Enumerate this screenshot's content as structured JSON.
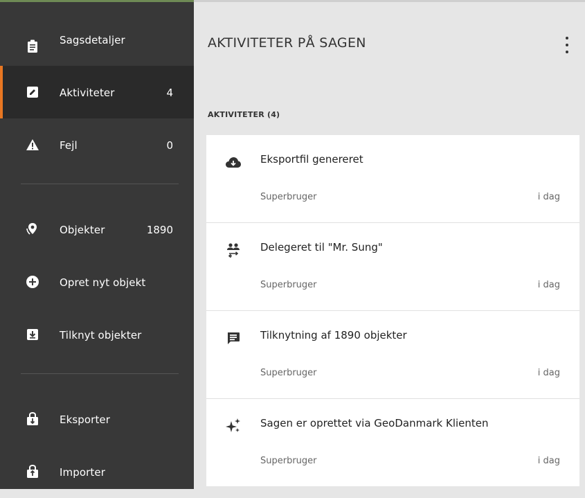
{
  "sidebar": {
    "items": [
      {
        "label": "Sagsdetaljer",
        "icon": "clipboard-icon",
        "count": ""
      },
      {
        "label": "Aktiviteter",
        "icon": "edit-note-icon",
        "count": "4"
      },
      {
        "label": "Fejl",
        "icon": "warning-icon",
        "count": "0"
      },
      {
        "label": "Objekter",
        "icon": "location-pin-icon",
        "count": "1890"
      },
      {
        "label": "Opret nyt objekt",
        "icon": "add-circle-icon",
        "count": ""
      },
      {
        "label": "Tilknyt objekter",
        "icon": "download-box-icon",
        "count": ""
      },
      {
        "label": "Eksporter",
        "icon": "lock-export-icon",
        "count": ""
      },
      {
        "label": "Importer",
        "icon": "lock-import-icon",
        "count": ""
      }
    ],
    "active_index": 1,
    "accent_color": "#e87722"
  },
  "main": {
    "title": "AKTIVITETER PÅ SAGEN",
    "section_title": "AKTIVITETER (4)",
    "activities": [
      {
        "icon": "cloud-download-icon",
        "title": "Eksportfil genereret",
        "user": "Superbruger",
        "time": "i dag"
      },
      {
        "icon": "people-transfer-icon",
        "title": "Delegeret til \"Mr. Sung\"",
        "user": "Superbruger",
        "time": "i dag"
      },
      {
        "icon": "comment-icon",
        "title": "Tilknytning af 1890 objekter",
        "user": "Superbruger",
        "time": "i dag"
      },
      {
        "icon": "sparkle-icon",
        "title": "Sagen er oprettet via GeoDanmark Klienten",
        "user": "Superbruger",
        "time": "i dag"
      }
    ]
  }
}
